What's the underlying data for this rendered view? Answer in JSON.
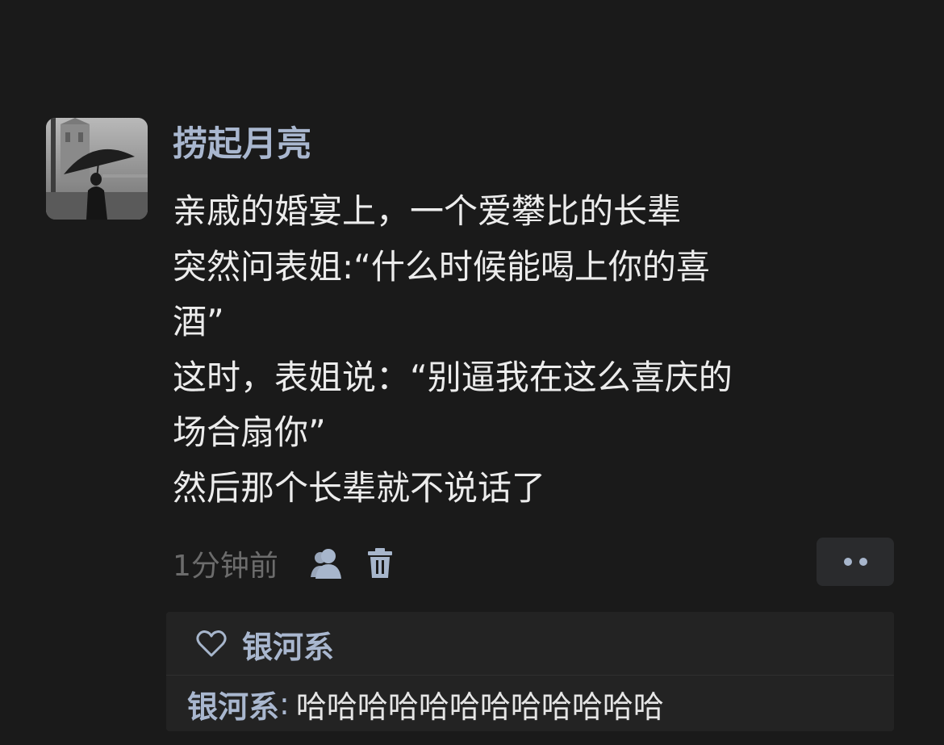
{
  "post": {
    "author": "捞起月亮",
    "lines": [
      "亲戚的婚宴上，一个爱攀比的长辈",
      "突然问表姐:“什么时候能喝上你的喜",
      "酒”",
      "这时，表姐说：“别逼我在这么喜庆的",
      "场合扇你”",
      "然后那个长辈就不说话了"
    ],
    "timestamp": "1分钟前"
  },
  "icons": {
    "avatar": "avatar-photo-person-with-umbrella",
    "visibility": "people-icon",
    "delete": "trash-icon",
    "more": "more-dots-icon",
    "like": "heart-icon"
  },
  "likes": {
    "names": "银河系"
  },
  "comments": [
    {
      "author": "银河系",
      "separator": ":",
      "text": "哈哈哈哈哈哈哈哈哈哈哈哈"
    }
  ],
  "colors": {
    "background": "#1a1a1a",
    "name_link": "#a9b7cf",
    "body_text": "#ececec",
    "meta_text": "#6c6c6c",
    "panel": "#232323"
  }
}
